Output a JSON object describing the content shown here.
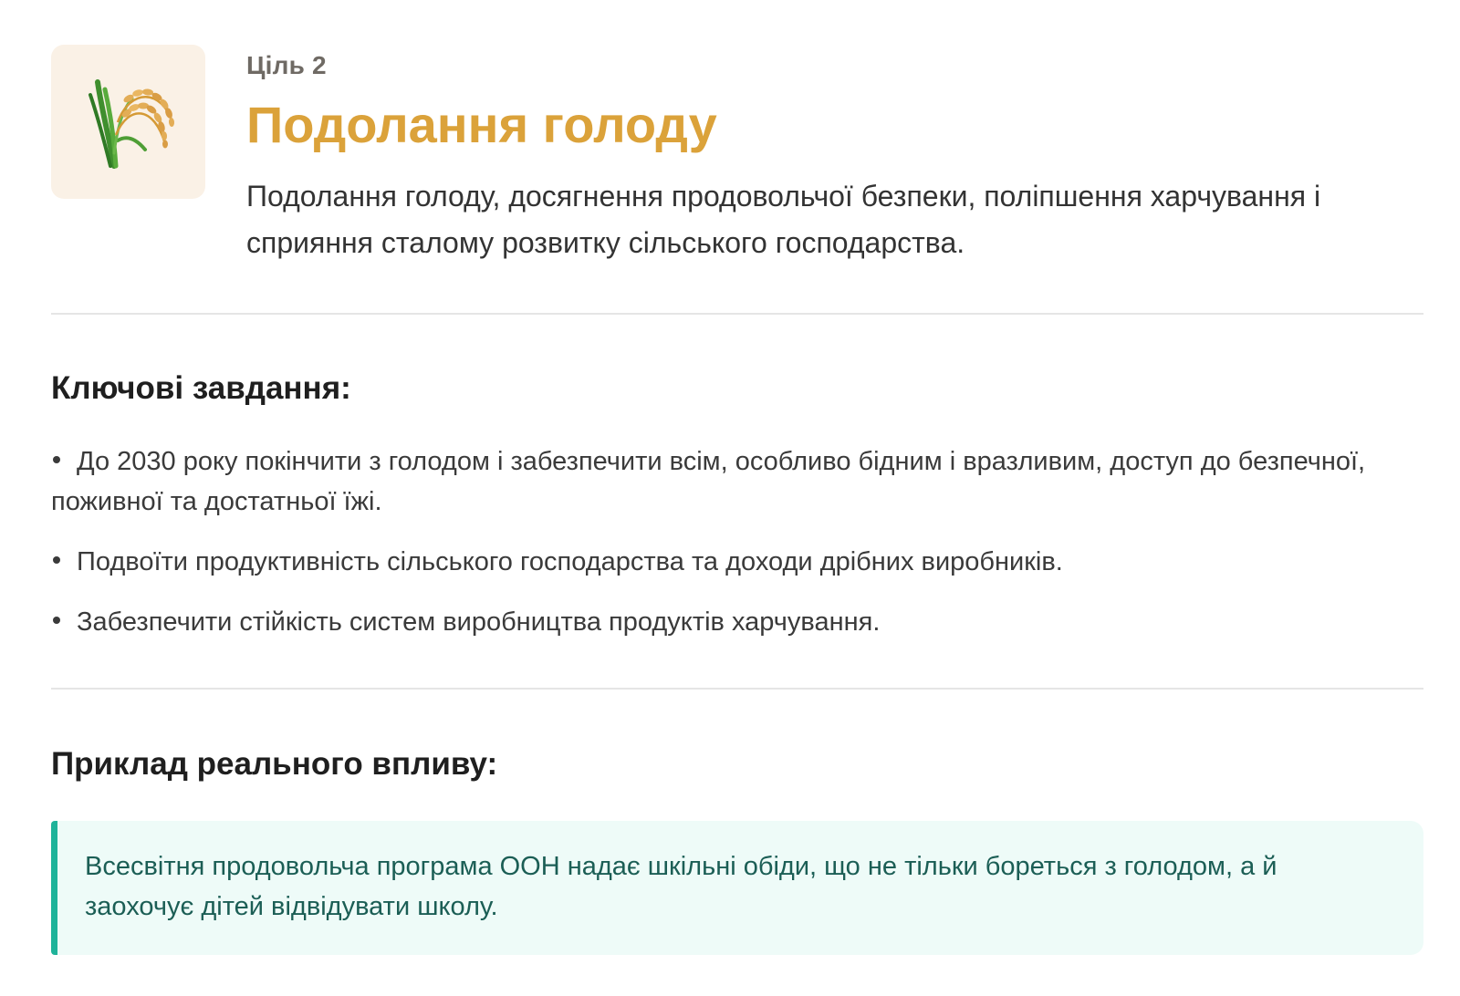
{
  "goal": {
    "icon": "rice-sheaf-icon",
    "label": "Ціль 2",
    "title": "Подолання голоду",
    "description": "Подолання голоду, досягнення продовольчої безпеки, поліпшення харчування і сприяння сталому розвитку сільського господарства.",
    "accent_color": "#dba23a",
    "tile_color": "#faf1e6"
  },
  "tasks": {
    "heading": "Ключові завдання:",
    "items": [
      "До 2030 року покінчити з голодом і забезпечити всім, особливо бідним і вразливим, доступ до безпечної, поживної та достатньої їжі.",
      "Подвоїти продуктивність сільського господарства та доходи дрібних виробників.",
      "Забезпечити стійкість систем виробництва продуктів харчування."
    ]
  },
  "impact": {
    "heading": "Приклад реального впливу:",
    "text": "Всесвітня продовольча програма ООН надає шкільні обіди, що не тільки бореться з голодом, а й заохочує дітей відвідувати школу.",
    "accent_color": "#1fb39a",
    "background_color": "#eefbf8"
  }
}
